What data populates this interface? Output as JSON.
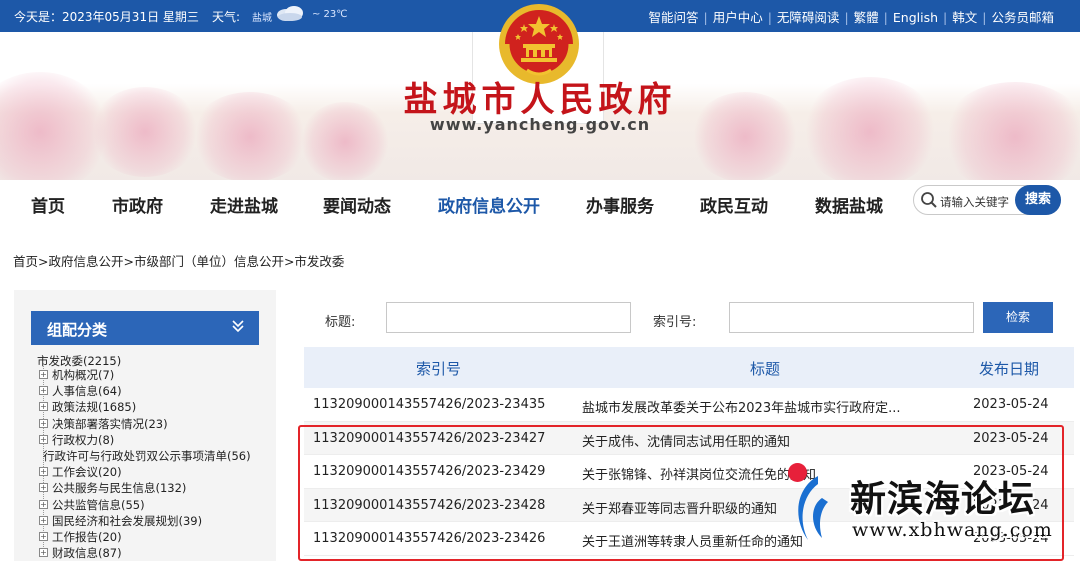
{
  "topbar": {
    "date": "今天是：2023年05月31日 星期三",
    "weather_label": "天气:",
    "weather_city": "盐城",
    "weather_temp": "~ 23℃",
    "links": [
      "智能问答",
      "用户中心",
      "无障碍阅读",
      "繁體",
      "English",
      "韩文",
      "公务员邮箱"
    ]
  },
  "banner": {
    "title": "盐城市人民政府",
    "url": "www.yancheng.gov.cn"
  },
  "nav": {
    "items": [
      "首页",
      "市政府",
      "走进盐城",
      "要闻动态",
      "政府信息公开",
      "办事服务",
      "政民互动",
      "数据盐城"
    ],
    "active": "政府信息公开",
    "search_placeholder": "请输入关键字",
    "search_button": "搜索"
  },
  "breadcrumb": "首页>政府信息公开>市级部门（单位）信息公开>市发改委",
  "sidebar": {
    "heading": "组配分类",
    "root": "市发改委(2215)",
    "items": [
      {
        "label": "机构概况(7)",
        "expandable": true
      },
      {
        "label": "人事信息(64)",
        "expandable": true
      },
      {
        "label": "政策法规(1685)",
        "expandable": true
      },
      {
        "label": "决策部署落实情况(23)",
        "expandable": true
      },
      {
        "label": "行政权力(8)",
        "expandable": true
      },
      {
        "label": "行政许可与行政处罚双公示事项清单(56)",
        "expandable": false
      },
      {
        "label": "工作会议(20)",
        "expandable": true
      },
      {
        "label": "公共服务与民生信息(132)",
        "expandable": true
      },
      {
        "label": "公共监管信息(55)",
        "expandable": true
      },
      {
        "label": "国民经济和社会发展规划(39)",
        "expandable": true
      },
      {
        "label": "工作报告(20)",
        "expandable": true
      },
      {
        "label": "财政信息(87)",
        "expandable": true
      }
    ]
  },
  "filters": {
    "title_label": "标题:",
    "title_value": "",
    "index_label": "索引号:",
    "index_value": "",
    "search_button": "检索"
  },
  "table": {
    "headers": [
      "索引号",
      "标题",
      "发布日期"
    ],
    "rows": [
      {
        "index": "113209000143557426/2023-23435",
        "title": "盐城市发展改革委关于公布2023年盐城市实行政府定...",
        "date": "2023-05-24"
      },
      {
        "index": "113209000143557426/2023-23427",
        "title": "关于成伟、沈倩同志试用任职的通知",
        "date": "2023-05-24"
      },
      {
        "index": "113209000143557426/2023-23429",
        "title": "关于张锦锋、孙祥淇岗位交流任免的通知",
        "date": "2023-05-24"
      },
      {
        "index": "113209000143557426/2023-23428",
        "title": "关于郑春亚等同志晋升职级的通知",
        "date": "2023-05-24"
      },
      {
        "index": "113209000143557426/2023-23426",
        "title": "关于王道洲等转隶人员重新任命的通知",
        "date": "2023-05-24"
      }
    ]
  },
  "watermark": {
    "cn": "新滨海论坛",
    "en": "www.xbhwang.com"
  },
  "colors": {
    "brand_blue": "#1d58a8",
    "header_blue": "#2c66b8",
    "title_red": "#c4141a",
    "highlight_red": "#e32429"
  }
}
